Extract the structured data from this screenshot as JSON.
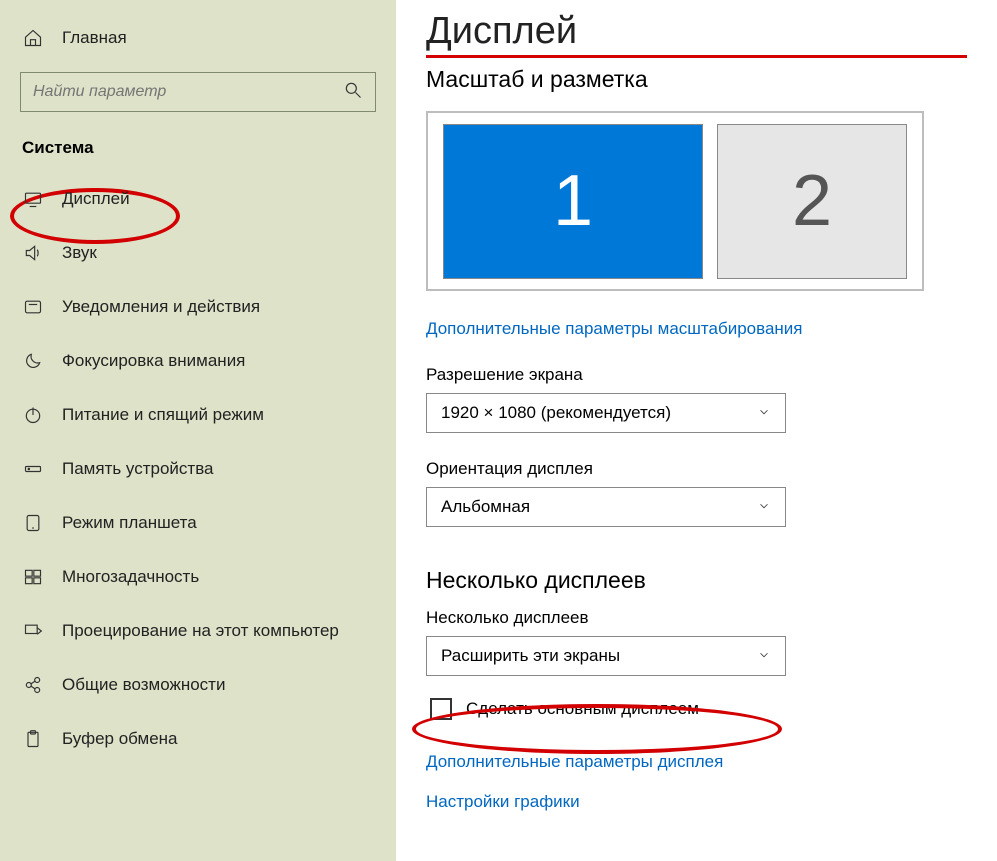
{
  "sidebar": {
    "home": "Главная",
    "search_placeholder": "Найти параметр",
    "section": "Система",
    "items": [
      "Дисплей",
      "Звук",
      "Уведомления и действия",
      "Фокусировка внимания",
      "Питание и спящий режим",
      "Память устройства",
      "Режим планшета",
      "Многозадачность",
      "Проецирование на этот компьютер",
      "Общие возможности",
      "Буфер обмена"
    ]
  },
  "main": {
    "title": "Дисплей",
    "scale_heading": "Масштаб и разметка",
    "display_1": "1",
    "display_2": "2",
    "adv_scale_link": "Дополнительные параметры масштабирования",
    "resolution_label": "Разрешение экрана",
    "resolution_value": "1920 × 1080 (рекомендуется)",
    "orientation_label": "Ориентация дисплея",
    "orientation_value": "Альбомная",
    "multi_heading": "Несколько дисплеев",
    "multi_label": "Несколько дисплеев",
    "multi_value": "Расширить эти экраны",
    "make_main_label": "Сделать основным дисплеем",
    "adv_display_link": "Дополнительные параметры дисплея",
    "graphics_link": "Настройки графики"
  }
}
